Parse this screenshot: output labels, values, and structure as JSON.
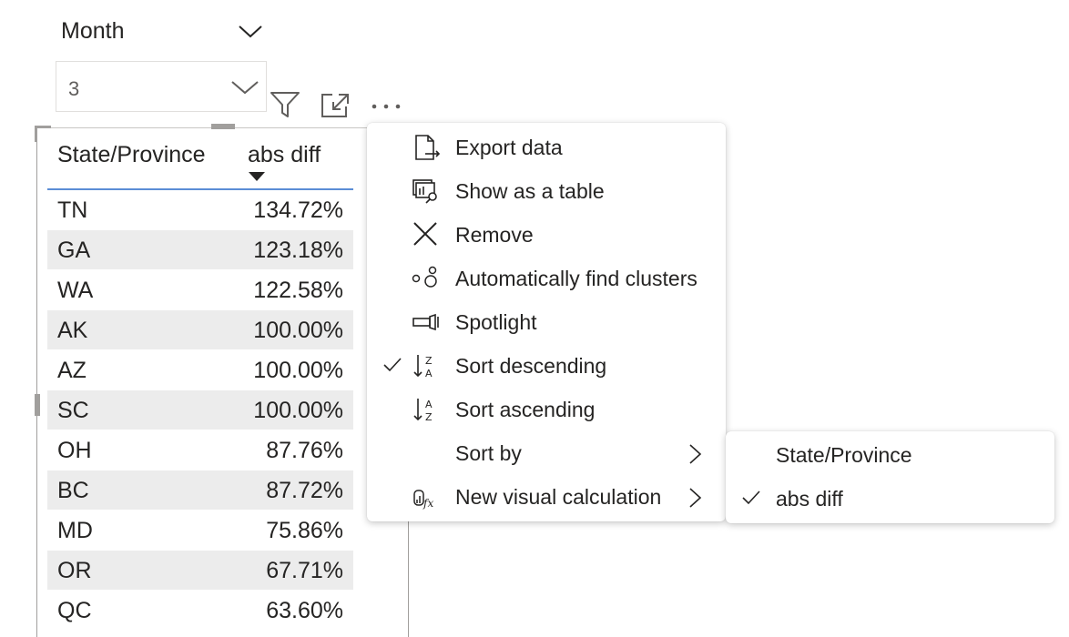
{
  "slicer": {
    "title": "Month",
    "selected": "3"
  },
  "table": {
    "columns": [
      "State/Province",
      "abs diff"
    ],
    "rows": [
      {
        "state": "TN",
        "value": "134.72%"
      },
      {
        "state": "GA",
        "value": "123.18%"
      },
      {
        "state": "WA",
        "value": "122.58%"
      },
      {
        "state": "AK",
        "value": "100.00%"
      },
      {
        "state": "AZ",
        "value": "100.00%"
      },
      {
        "state": "SC",
        "value": "100.00%"
      },
      {
        "state": "OH",
        "value": "87.76%"
      },
      {
        "state": "BC",
        "value": "87.72%"
      },
      {
        "state": "MD",
        "value": "75.86%"
      },
      {
        "state": "OR",
        "value": "67.71%"
      },
      {
        "state": "QC",
        "value": "63.60%"
      }
    ]
  },
  "menu": {
    "items": [
      {
        "label": "Export data",
        "icon": "export-icon",
        "checked": false,
        "submenu": false
      },
      {
        "label": "Show as a table",
        "icon": "table-view-icon",
        "checked": false,
        "submenu": false
      },
      {
        "label": "Remove",
        "icon": "close-icon",
        "checked": false,
        "submenu": false
      },
      {
        "label": "Automatically find clusters",
        "icon": "clusters-icon",
        "checked": false,
        "submenu": false
      },
      {
        "label": "Spotlight",
        "icon": "spotlight-icon",
        "checked": false,
        "submenu": false
      },
      {
        "label": "Sort descending",
        "icon": "sort-descending-icon",
        "checked": true,
        "submenu": false
      },
      {
        "label": "Sort ascending",
        "icon": "sort-ascending-icon",
        "checked": false,
        "submenu": false
      },
      {
        "label": "Sort by",
        "icon": "",
        "checked": false,
        "submenu": true
      },
      {
        "label": "New visual calculation",
        "icon": "visual-calculation-icon",
        "checked": false,
        "submenu": true
      }
    ]
  },
  "submenu": {
    "items": [
      {
        "label": "State/Province",
        "checked": false
      },
      {
        "label": "abs diff",
        "checked": true
      }
    ]
  },
  "colors": {
    "accent": "#5b8dd6",
    "row_alt": "#ececec",
    "text": "#252423"
  }
}
